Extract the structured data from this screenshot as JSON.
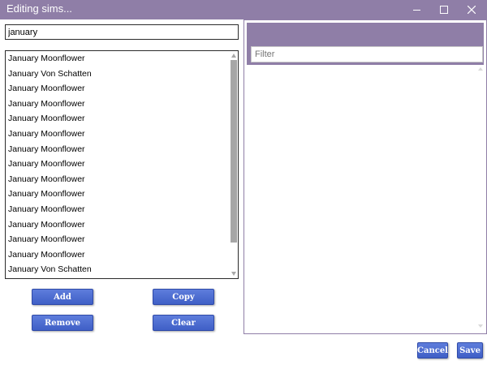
{
  "window": {
    "title": "Editing sims...",
    "accent_color": "#8f7ea7",
    "button_color": "#4a6bd2"
  },
  "left": {
    "search_value": "january",
    "list_items": [
      "January Moonflower",
      "January Von Schatten",
      "January Moonflower",
      "January Moonflower",
      "January Moonflower",
      "January Moonflower",
      "January Moonflower",
      "January Moonflower",
      "January Moonflower",
      "January Moonflower",
      "January Moonflower",
      "January Moonflower",
      "January Moonflower",
      "January Moonflower",
      "January Von Schatten"
    ],
    "buttons": {
      "add": "Add",
      "copy": "Copy",
      "remove": "Remove",
      "clear": "Clear"
    }
  },
  "right": {
    "filter_placeholder": "Filter"
  },
  "footer": {
    "cancel": "Cancel",
    "save": "Save"
  }
}
